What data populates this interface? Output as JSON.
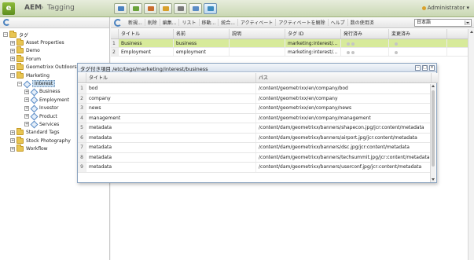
{
  "app": {
    "logo_letter": "e",
    "name": "AEM",
    "separator": "›",
    "section": "Tagging",
    "user": "Administrator",
    "nav_icons": [
      {
        "icon": "websites-icon",
        "color": "#4a82bf"
      },
      {
        "icon": "digital-assets-icon",
        "color": "#6aa33a"
      },
      {
        "icon": "communities-icon",
        "color": "#c96e2f"
      },
      {
        "icon": "campaigns-icon",
        "color": "#d8a02a"
      },
      {
        "icon": "inbox-icon",
        "color": "#7a7a7a"
      },
      {
        "icon": "users-icon",
        "color": "#5b8cc6"
      },
      {
        "icon": "tagging-icon",
        "color": "#3d8bbf"
      }
    ]
  },
  "tree": {
    "items": [
      {
        "label": "タグ",
        "level": 0,
        "expander": "−",
        "icon": "folder"
      },
      {
        "label": "Asset Properties",
        "level": 1,
        "expander": "+",
        "icon": "folder"
      },
      {
        "label": "Demo",
        "level": 1,
        "expander": "+",
        "icon": "folder"
      },
      {
        "label": "Forum",
        "level": 1,
        "expander": "+",
        "icon": "folder"
      },
      {
        "label": "Geometrixx Outdoors",
        "level": 1,
        "expander": "+",
        "icon": "folder"
      },
      {
        "label": "Marketing",
        "level": 1,
        "expander": "−",
        "icon": "folder"
      },
      {
        "label": "Interest",
        "level": 2,
        "expander": "−",
        "icon": "tag",
        "selected": true
      },
      {
        "label": "Business",
        "level": 3,
        "expander": "+",
        "icon": "tag"
      },
      {
        "label": "Employment",
        "level": 3,
        "expander": "+",
        "icon": "tag"
      },
      {
        "label": "Investor",
        "level": 3,
        "expander": "+",
        "icon": "tag"
      },
      {
        "label": "Product",
        "level": 3,
        "expander": "+",
        "icon": "tag"
      },
      {
        "label": "Services",
        "level": 3,
        "expander": "+",
        "icon": "tag"
      },
      {
        "label": "Standard Tags",
        "level": 1,
        "expander": "+",
        "icon": "folder"
      },
      {
        "label": "Stock Photography",
        "level": 1,
        "expander": "+",
        "icon": "folder"
      },
      {
        "label": "Workflow",
        "level": 1,
        "expander": "+",
        "icon": "folder"
      }
    ]
  },
  "toolbar": {
    "buttons": [
      "新規...",
      "削除",
      "編集...",
      "リスト",
      "移動...",
      "統合...",
      "アクティベート",
      "アクティベートを解除",
      "ヘルプ",
      "数の使用済"
    ],
    "language": "日本語"
  },
  "grid": {
    "columns": [
      "タイトル",
      "名前",
      "説明",
      "タグ ID",
      "発行済み",
      "変更済み"
    ],
    "rows": [
      {
        "num": "1",
        "title": "Business",
        "name": "business",
        "desc": "",
        "tagid": "marketing:interest/bu...",
        "selected": true
      },
      {
        "num": "2",
        "title": "Employment",
        "name": "employment",
        "desc": "",
        "tagid": "marketing:interest/em..."
      }
    ]
  },
  "popup": {
    "title": "タグ付き項目 /etc/tags/marketing/interest/business",
    "columns": [
      "タイトル",
      "パス"
    ],
    "rows": [
      {
        "num": "1",
        "title": "bod",
        "path": "/content/geometrixx/en/company/bod"
      },
      {
        "num": "2",
        "title": "company",
        "path": "/content/geometrixx/en/company"
      },
      {
        "num": "3",
        "title": "news",
        "path": "/content/geometrixx/en/company/news"
      },
      {
        "num": "4",
        "title": "management",
        "path": "/content/geometrixx/en/company/management"
      },
      {
        "num": "5",
        "title": "metadata",
        "path": "/content/dam/geometrixx/banners/shapecon.jpg/jcr:content/metadata"
      },
      {
        "num": "6",
        "title": "metadata",
        "path": "/content/dam/geometrixx/banners/airport.jpg/jcr:content/metadata"
      },
      {
        "num": "7",
        "title": "metadata",
        "path": "/content/dam/geometrixx/banners/dsc.jpg/jcr:content/metadata"
      },
      {
        "num": "8",
        "title": "metadata",
        "path": "/content/dam/geometrixx/banners/techsummit.jpg/jcr:content/metadata"
      },
      {
        "num": "9",
        "title": "metadata",
        "path": "/content/dam/geometrixx/banners/userconf.jpg/jcr:content/metadata"
      }
    ]
  }
}
